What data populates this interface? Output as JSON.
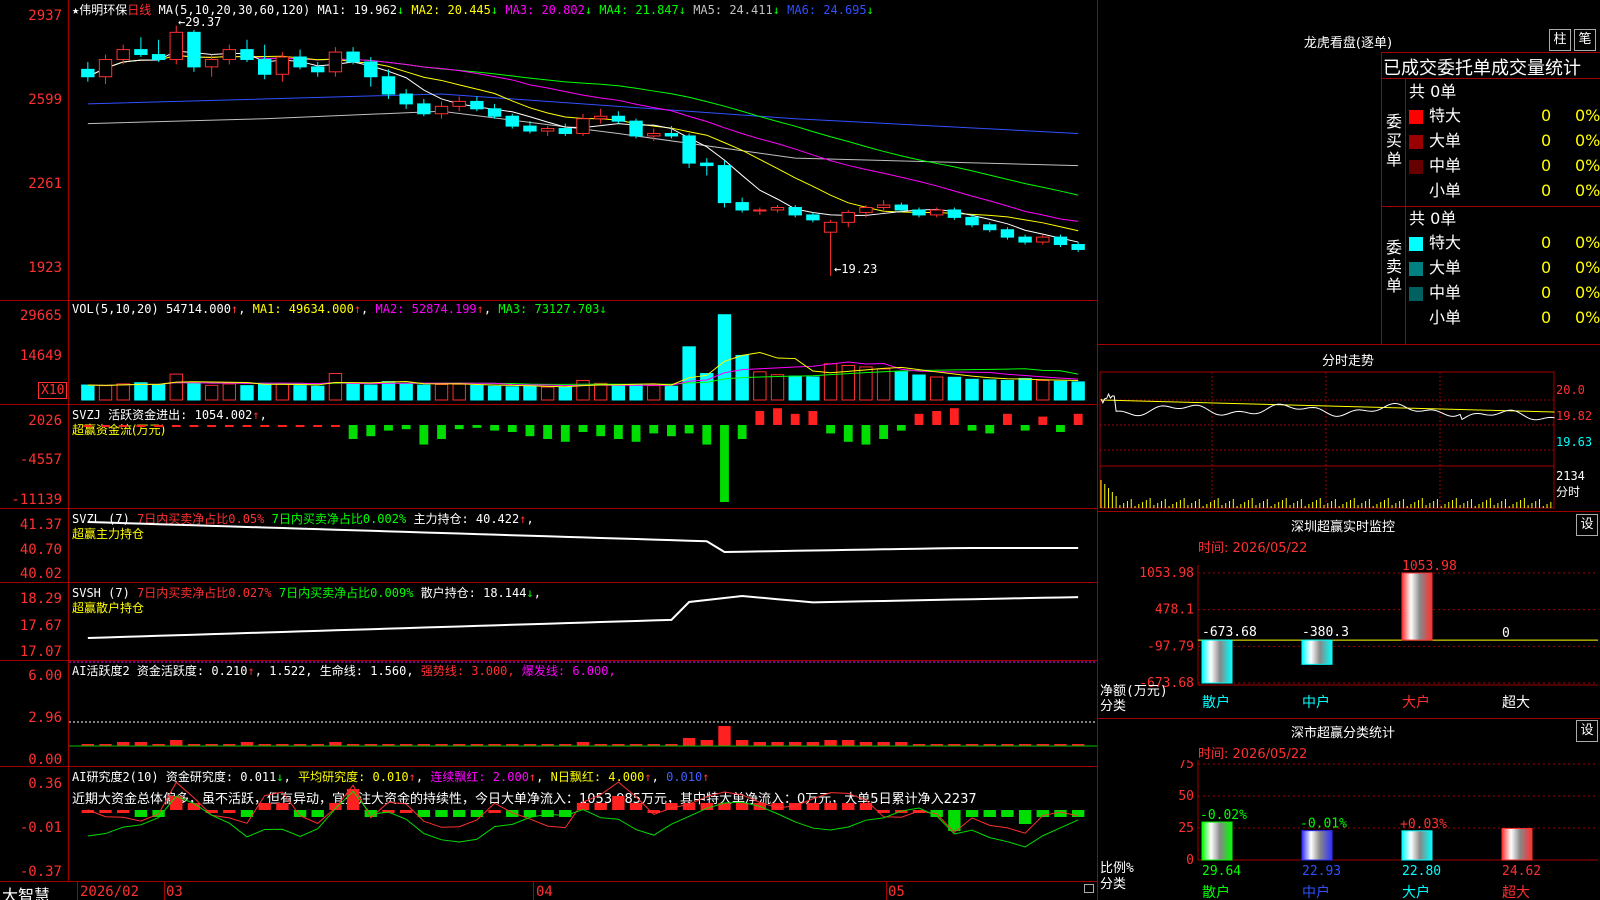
{
  "stock": {
    "name": "伟明环保",
    "period": "日线",
    "ma_params": "MA(5,10,20,30,60,120)",
    "ma": [
      {
        "label": "MA1:",
        "value": "19.962",
        "arrow": "↓",
        "color": "#ffffff"
      },
      {
        "label": "MA2:",
        "value": "20.445",
        "arrow": "↓",
        "color": "#ffff00"
      },
      {
        "label": "MA3:",
        "value": "20.802",
        "arrow": "↓",
        "color": "#ff00ff"
      },
      {
        "label": "MA4:",
        "value": "21.847",
        "arrow": "↓",
        "color": "#00ff00"
      },
      {
        "label": "MA5:",
        "value": "24.411",
        "arrow": "↓",
        "color": "#c0c0c0"
      },
      {
        "label": "MA6:",
        "value": "24.695",
        "arrow": "↓",
        "color": "#3050ff"
      }
    ],
    "high_mark": "←29.37",
    "low_mark": "←19.23"
  },
  "price_axis": [
    "2937",
    "2599",
    "2261",
    "1923"
  ],
  "vol": {
    "header": "VOL(5,10,20)",
    "value": "54714.000",
    "ma1": "MA1: 49634.000",
    "ma2": "MA2: 52874.199",
    "ma3": "MA3: 73127.703",
    "axis": [
      "29665",
      "14649"
    ],
    "unit": "X10"
  },
  "svzj": {
    "header": "SVZJ",
    "text": "活跃资金进出: 1054.002",
    "subtitle": "超赢资金流(万元)",
    "axis": [
      "2026",
      "-4557",
      "-11139"
    ]
  },
  "svzl": {
    "header": "SVZL (7)",
    "t1": "7日内买卖净占比0.05%",
    "t2": "7日内买卖净占比0.002%",
    "t3": "主力持仓: 40.422",
    "subtitle": "超赢主力持仓",
    "axis": [
      "41.37",
      "40.70",
      "40.02"
    ]
  },
  "svsh": {
    "header": "SVSH (7)",
    "t1": "7日内买卖净占比0.027%",
    "t2": "7日内买卖净占比0.009%",
    "t3": "散户持仓: 18.144",
    "subtitle": "超赢散户持仓",
    "axis": [
      "18.29",
      "17.67",
      "17.07"
    ]
  },
  "ai1": {
    "header": "AI活跃度2",
    "t1": "资金活跃度: 0.210",
    "t2": "1.522,",
    "t3": "生命线: 1.560,",
    "t4": "强势线: 3.000,",
    "t5": "爆发线: 6.000,",
    "axis": [
      "6.00",
      "2.96",
      "0.00"
    ]
  },
  "ai2": {
    "header": "AI研究度2(10)",
    "t1": "资金研究度: 0.011",
    "t2": "平均研究度: 0.010",
    "t3": "连续飘红: 2.000",
    "t4": "N日飘红: 4.000",
    "t5": "0.010",
    "comment": "近期大资金总体偏多，虽不活跃，但有异动，宜关注大资金的持续性，今日大单净流入：1053.985万元，其中特大单净流入：0万元，大单5日累计净入2237",
    "axis": [
      "0.36",
      "-0.01",
      "-0.37"
    ]
  },
  "dates": [
    "2026/02",
    "03",
    "04",
    "05"
  ],
  "brand": "大智慧",
  "right": {
    "lhb_title": "龙虎看盘(逐单)",
    "btn_zhu": "柱",
    "btn_bi": "笔",
    "stat_title": "已成交委托单成交量统计",
    "buy_label": "委买单",
    "sell_label": "委卖单",
    "buy_total": "共 0单",
    "sell_total": "共 0单",
    "buy_rows": [
      {
        "name": "特大",
        "count": "0",
        "pct": "0%",
        "color": "#ff0000"
      },
      {
        "name": "大单",
        "count": "0",
        "pct": "0%",
        "color": "#990000"
      },
      {
        "name": "中单",
        "count": "0",
        "pct": "0%",
        "color": "#660000"
      },
      {
        "name": "小单",
        "count": "0",
        "pct": "0%",
        "color": "#000000"
      }
    ],
    "sell_rows": [
      {
        "name": "特大",
        "count": "0",
        "pct": "0%",
        "color": "#00ffff"
      },
      {
        "name": "大单",
        "count": "0",
        "pct": "0%",
        "color": "#008080"
      },
      {
        "name": "中单",
        "count": "0",
        "pct": "0%",
        "color": "#006060"
      },
      {
        "name": "小单",
        "count": "0",
        "pct": "0%",
        "color": "#000000"
      }
    ],
    "fs_title": "分时走势",
    "fs_axis": [
      "20.0",
      "19.82",
      "19.63"
    ],
    "fs_vol": "2134",
    "fs_unit": "分时",
    "monitor_title": "深圳超赢实时监控",
    "monitor_btn": "设",
    "monitor_time": "时间: 2026/05/22",
    "monitor_axis": [
      "1053.98",
      "478.1",
      "-97.79",
      "-673.68"
    ],
    "monitor_ylabel": "净额(万元)",
    "monitor_xlabel": "分类",
    "monitor_cats": [
      "散户",
      "中户",
      "大户",
      "超大"
    ],
    "monitor_values": [
      "-673.68",
      "-380.3",
      "1053.98",
      "0"
    ],
    "class_title": "深市超赢分类统计",
    "class_btn": "设",
    "class_time": "时间: 2026/05/22",
    "class_axis": [
      "75",
      "50",
      "25",
      "0"
    ],
    "class_ylabel": "比例%",
    "class_xlabel": "分类",
    "class_cats": [
      "散户",
      "中户",
      "大户",
      "超大"
    ],
    "class_changes": [
      "-0.02%",
      "-0.01%",
      "+0.03%",
      ""
    ],
    "class_values": [
      "29.64",
      "22.93",
      "22.80",
      "24.62"
    ]
  },
  "chart_data": [
    {
      "type": "candlestick",
      "title": "伟明环保 日线",
      "ylim": [
        19.23,
        29.37
      ],
      "ohlc": [
        [
          27.6,
          27.9,
          27.1,
          27.3
        ],
        [
          27.3,
          28.2,
          27.0,
          28.0
        ],
        [
          28.0,
          28.6,
          27.8,
          28.4
        ],
        [
          28.4,
          28.9,
          28.1,
          28.2
        ],
        [
          28.2,
          28.8,
          27.9,
          28.0
        ],
        [
          28.0,
          29.37,
          27.8,
          29.1
        ],
        [
          29.1,
          29.2,
          27.5,
          27.7
        ],
        [
          27.7,
          28.2,
          27.3,
          28.0
        ],
        [
          28.0,
          28.6,
          27.8,
          28.4
        ],
        [
          28.4,
          28.8,
          27.9,
          28.0
        ],
        [
          28.0,
          28.6,
          27.2,
          27.4
        ],
        [
          27.4,
          28.3,
          27.1,
          28.1
        ],
        [
          28.1,
          28.4,
          27.6,
          27.7
        ],
        [
          27.7,
          27.9,
          27.3,
          27.5
        ],
        [
          27.5,
          28.5,
          27.3,
          28.3
        ],
        [
          28.3,
          28.5,
          27.8,
          27.9
        ],
        [
          27.9,
          28.1,
          26.9,
          27.3
        ],
        [
          27.3,
          27.6,
          26.4,
          26.6
        ],
        [
          26.6,
          26.8,
          26.0,
          26.2
        ],
        [
          26.2,
          26.4,
          25.7,
          25.8
        ],
        [
          25.8,
          26.3,
          25.6,
          26.1
        ],
        [
          26.1,
          26.5,
          25.9,
          26.3
        ],
        [
          26.3,
          26.5,
          25.9,
          26.0
        ],
        [
          26.0,
          26.2,
          25.6,
          25.7
        ],
        [
          25.7,
          25.8,
          25.2,
          25.3
        ],
        [
          25.3,
          25.5,
          25.0,
          25.1
        ],
        [
          25.1,
          25.3,
          24.9,
          25.2
        ],
        [
          25.2,
          25.4,
          24.9,
          25.0
        ],
        [
          25.0,
          25.8,
          24.9,
          25.6
        ],
        [
          25.6,
          26.0,
          25.4,
          25.7
        ],
        [
          25.7,
          25.9,
          25.4,
          25.5
        ],
        [
          25.5,
          25.6,
          24.8,
          24.9
        ],
        [
          24.9,
          25.2,
          24.7,
          25.0
        ],
        [
          25.0,
          25.3,
          24.8,
          24.9
        ],
        [
          24.9,
          25.0,
          23.6,
          23.8
        ],
        [
          23.8,
          24.0,
          23.3,
          23.7
        ],
        [
          23.7,
          23.9,
          22.0,
          22.2
        ],
        [
          22.2,
          22.4,
          21.8,
          21.9
        ],
        [
          21.9,
          22.0,
          21.7,
          21.9
        ],
        [
          21.9,
          22.1,
          21.8,
          22.0
        ],
        [
          22.0,
          22.1,
          21.6,
          21.7
        ],
        [
          21.7,
          21.8,
          21.4,
          21.5
        ],
        [
          21.0,
          21.5,
          19.23,
          21.4
        ],
        [
          21.4,
          21.9,
          21.2,
          21.8
        ],
        [
          21.8,
          22.1,
          21.6,
          22.0
        ],
        [
          22.0,
          22.3,
          21.8,
          22.1
        ],
        [
          22.1,
          22.2,
          21.8,
          21.9
        ],
        [
          21.9,
          22.0,
          21.6,
          21.7
        ],
        [
          21.7,
          22.0,
          21.6,
          21.9
        ],
        [
          21.9,
          22.0,
          21.5,
          21.6
        ],
        [
          21.6,
          21.7,
          21.2,
          21.3
        ],
        [
          21.3,
          21.4,
          21.0,
          21.1
        ],
        [
          21.1,
          21.2,
          20.7,
          20.8
        ],
        [
          20.8,
          20.9,
          20.5,
          20.6
        ],
        [
          20.6,
          20.9,
          20.5,
          20.8
        ],
        [
          20.8,
          20.9,
          20.4,
          20.5
        ],
        [
          20.5,
          20.6,
          20.2,
          20.3
        ]
      ]
    },
    {
      "type": "bar",
      "title": "VOL(5,10,20)",
      "ylim": [
        0,
        32000
      ],
      "values": [
        5200,
        5000,
        5600,
        6000,
        5400,
        9000,
        5800,
        5100,
        5600,
        5000,
        5800,
        5600,
        5000,
        4800,
        9200,
        5600,
        5200,
        6400,
        5800,
        5200,
        5400,
        5500,
        5100,
        4800,
        4600,
        4800,
        4500,
        4400,
        6800,
        5800,
        5100,
        5400,
        5000,
        4800,
        18500,
        9200,
        29665,
        15500,
        9800,
        8800,
        8300,
        8000,
        12600,
        12000,
        11500,
        10800,
        9800,
        8700,
        8000,
        7900,
        7200,
        7000,
        6800,
        7500,
        6800,
        6500,
        6300
      ]
    }
  ]
}
